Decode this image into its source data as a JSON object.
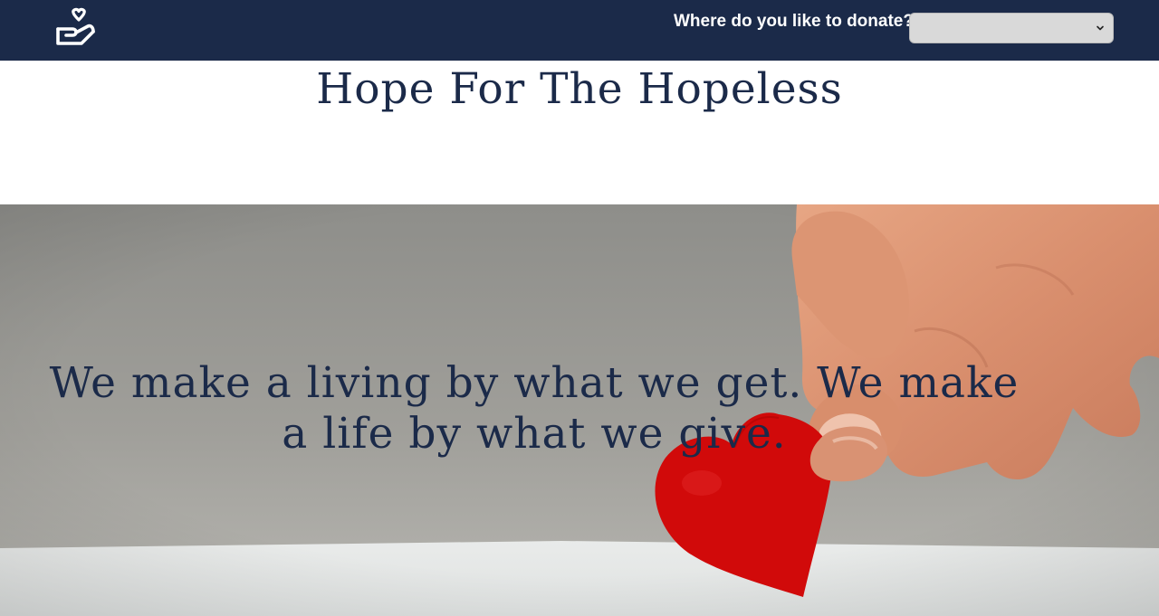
{
  "header": {
    "logo_icon": "hand-heart-icon",
    "donate_label": "Where do you like to donate?",
    "donate_select": {
      "selected_value": "",
      "icon": "chevron-down-icon"
    },
    "background_color": "#1b2a49"
  },
  "title": {
    "text": "Hope For The Hopeless",
    "color": "#1b2a49"
  },
  "hero": {
    "quote": "We make a living by what we get. We make a life by what we give.",
    "heart_color": "#d40000"
  }
}
